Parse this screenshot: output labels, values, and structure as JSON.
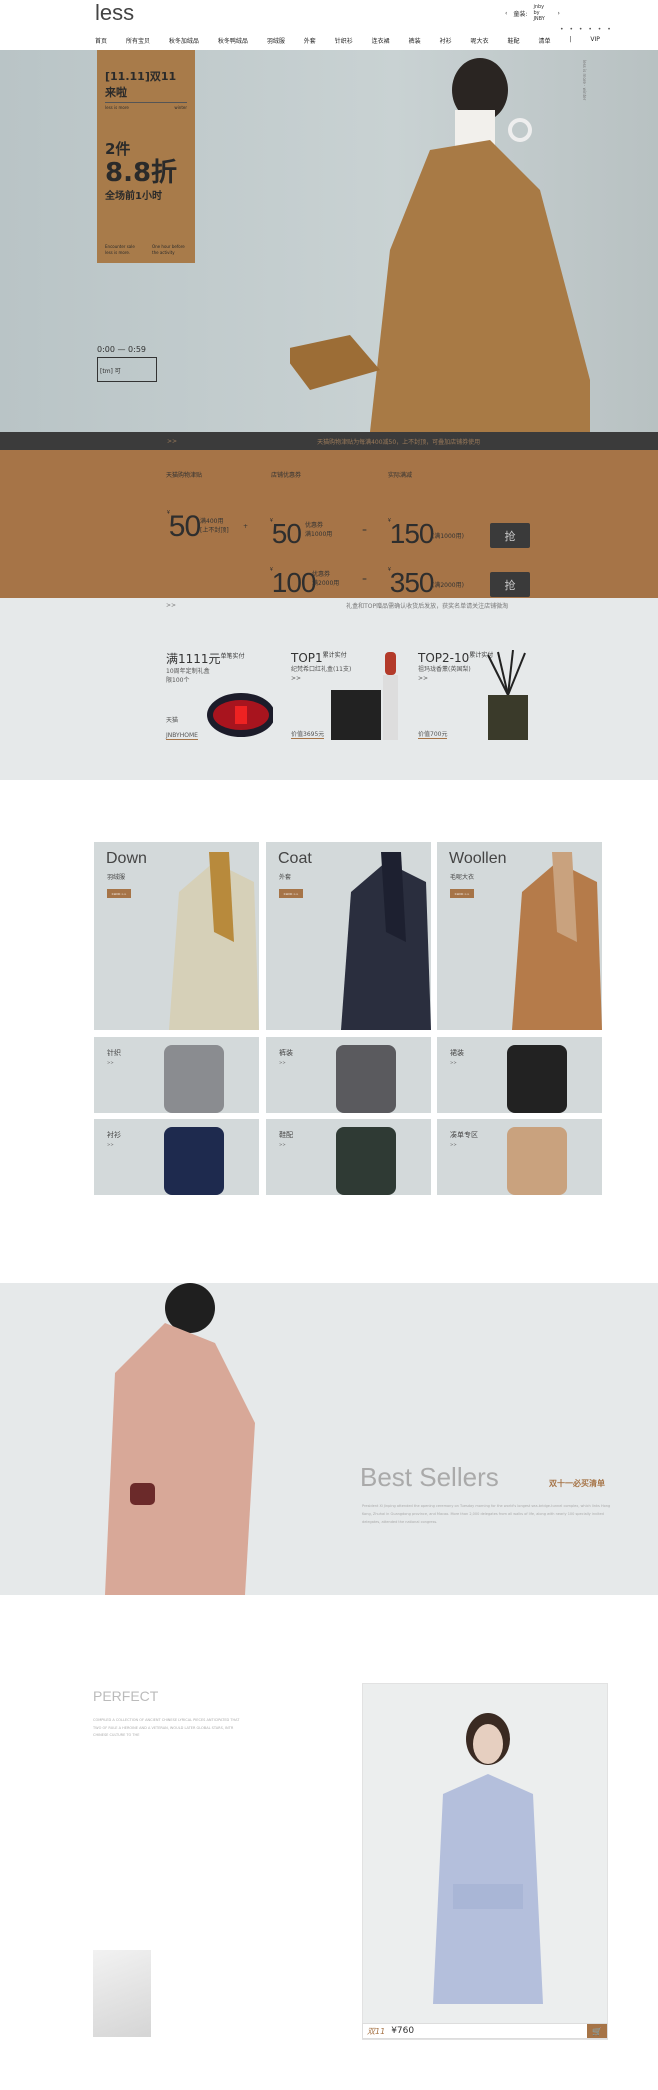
{
  "header": {
    "logo": "less",
    "kids_label": "童装:",
    "kids_brand": "jnby by JNBY",
    "dots": "• • • • • •",
    "nav": [
      "首页",
      "所有宝贝",
      "秋冬加绒品",
      "秋冬鸭绒品",
      "羽绒服",
      "外套",
      "针织衫",
      "连衣裙",
      "裤装",
      "衬衫",
      "呢大衣",
      "鞋配",
      "清单",
      "|",
      "VIP"
    ]
  },
  "banner": {
    "tag_title": "[11.11]双11来啦",
    "tag_sub_left": "less is more",
    "tag_sub_right": "winter",
    "line1": "2件",
    "line2": "8.8折",
    "line3": "全场前1小时",
    "foot_left": "Encounter sale less is more.",
    "foot_right": "One hour before the activity",
    "time": "0:00 — 0:59",
    "tm_logo": "[tm] 可",
    "vertical_text": "less is more · winter"
  },
  "notice1": {
    "arrow": ">>",
    "text": "天猫购物津贴为每满400减50，上不封顶，可叠加店铺券使用"
  },
  "coupons": {
    "headers": [
      "天猫购物津贴",
      "店铺优惠券",
      "实际满减"
    ],
    "allowance": {
      "currency": "¥",
      "value": "50",
      "desc1": "满400用",
      "desc2": "[上不封顶]"
    },
    "plus": "+",
    "equals": "=",
    "rows": [
      {
        "coupon": "50",
        "coupon_desc1": "优惠券",
        "coupon_desc2": "满1000用",
        "total": "150",
        "total_desc": "(满1000用)",
        "button": "抢"
      },
      {
        "coupon": "100",
        "coupon_desc1": "优惠券",
        "coupon_desc2": "满2000用",
        "total": "350",
        "total_desc": "(满2000用)",
        "button": "抢"
      }
    ]
  },
  "notice2": {
    "arrow": ">>",
    "text": "礼盒和TOP赠品需确认收货后发放，获奖名单请关注店铺微淘"
  },
  "gifts": [
    {
      "title": "满1111元",
      "sup": "单笔实付",
      "desc1": "10周年定制礼盒",
      "desc2": "限100个",
      "brand1": "天猫",
      "brand2": "JNBYHOME"
    },
    {
      "title": "TOP1",
      "sup": "累计实付",
      "desc1": "纪梵希口红礼盒(11支)",
      "desc2": ">>",
      "price": "价值3695元"
    },
    {
      "title": "TOP2-10",
      "sup": "累计实付",
      "desc1": "祖玛珑香薰(英国梨)",
      "desc2": ">>",
      "price": "价值700元"
    }
  ],
  "categories": {
    "big": [
      {
        "en": "Down",
        "cn": "羽绒服",
        "click": "CLICK >>"
      },
      {
        "en": "Coat",
        "cn": "外套",
        "click": "CLICK >>"
      },
      {
        "en": "Woollen",
        "cn": "毛呢大衣",
        "click": "CLICK >>"
      }
    ],
    "small": [
      {
        "cn": "针织",
        "arrow": ">>"
      },
      {
        "cn": "裤装",
        "arrow": ">>"
      },
      {
        "cn": "裙装",
        "arrow": ">>"
      },
      {
        "cn": "衬衫",
        "arrow": ">>"
      },
      {
        "cn": "鞋配",
        "arrow": ">>"
      },
      {
        "cn": "凑单专区",
        "arrow": ">>"
      }
    ]
  },
  "best_sellers": {
    "title": "Best  Sellers",
    "cn": "双十一必买清单",
    "text": "President Xi Jinping attended the opening ceremony on Tuesday morning for the world's longest sea-bridge-tunnel complex, which links Hong Kong, Zhuhai in Guangdong province, and Macao. More than 2,000 delegates from all walks of life, along with nearly 100 specially invited delegates, attended the national congress."
  },
  "perfect": {
    "title": "PERFECT",
    "text": "COMPILED A COLLECTION OF ANCIENT CHINESE LYRICAL PIECES ANTICIPATED THAT TWO OF RULE A HEROINE AND A VETERAN, WOULD LATER GLOBAL STARS, INTR CHINESE CULTURE TO THE"
  },
  "product": {
    "tag": "双11",
    "price": "¥760"
  },
  "colors": {
    "accent": "#a67447",
    "dark": "#3b3b3b",
    "bg_gray": "#e6e9ea"
  }
}
